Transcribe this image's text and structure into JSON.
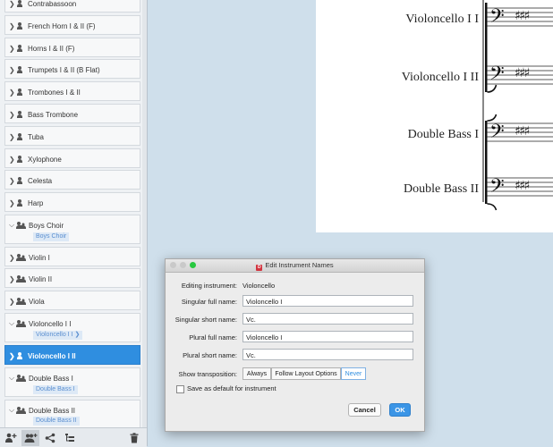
{
  "instrument_list": {
    "items": [
      {
        "label": "Contrabassoon",
        "icon": "person-icon",
        "collapsed": true
      },
      {
        "label": "French Horn I & II (F)",
        "icon": "person-icon",
        "collapsed": true
      },
      {
        "label": "Horns I & II (F)",
        "icon": "person-icon",
        "collapsed": true
      },
      {
        "label": "Trumpets I & II (B Flat)",
        "icon": "person-icon",
        "collapsed": true
      },
      {
        "label": "Trombones I & II",
        "icon": "person-icon",
        "collapsed": true
      },
      {
        "label": "Bass Trombone",
        "icon": "person-icon",
        "collapsed": true
      },
      {
        "label": "Tuba",
        "icon": "person-icon",
        "collapsed": true
      },
      {
        "label": "Xylophone",
        "icon": "person-icon",
        "collapsed": true
      },
      {
        "label": "Celesta",
        "icon": "person-icon",
        "collapsed": true
      },
      {
        "label": "Harp",
        "icon": "person-icon",
        "collapsed": true
      },
      {
        "label": "Boys Choir",
        "icon": "group-icon",
        "collapsed": false,
        "tag": "Boys Choir"
      },
      {
        "label": "Violin I",
        "icon": "group-icon",
        "collapsed": true
      },
      {
        "label": "Violin II",
        "icon": "group-icon",
        "collapsed": true
      },
      {
        "label": "Viola",
        "icon": "group-icon",
        "collapsed": true
      },
      {
        "label": "Violoncello I I",
        "icon": "group-icon",
        "collapsed": false,
        "tag": "Violoncello I I"
      },
      {
        "label": "Violoncello I II",
        "icon": "person-icon",
        "collapsed": true,
        "selected": true
      },
      {
        "label": "Double Bass I",
        "icon": "group-icon",
        "collapsed": false,
        "tag": "Double Bass I"
      },
      {
        "label": "Double Bass II",
        "icon": "group-icon",
        "collapsed": false,
        "tag": "Double Bass II"
      }
    ]
  },
  "toolbar": {
    "buttons": [
      "add-solo-player-icon",
      "add-section-player-icon",
      "share-icon",
      "hierarchy-icon"
    ],
    "trash": "trash-icon"
  },
  "score": {
    "staves": [
      "Violoncello I I",
      "Violoncello I II",
      "Double Bass I",
      "Double Bass II"
    ],
    "clef": "𝄢",
    "key_signature": "♯ ♯ ♯"
  },
  "dialog": {
    "title": "Edit Instrument Names",
    "editing_label": "Editing instrument:",
    "editing_value": "Violoncello",
    "singular_full_label": "Singular full name:",
    "singular_full_value": "Violoncello I",
    "singular_short_label": "Singular short name:",
    "singular_short_value": "Vc.",
    "plural_full_label": "Plural full name:",
    "plural_full_value": "Violoncello I",
    "plural_short_label": "Plural short name:",
    "plural_short_value": "Vc.",
    "transposition_label": "Show transposition:",
    "transposition_options": [
      "Always",
      "Follow Layout Options",
      "Never"
    ],
    "transposition_selected": "Never",
    "save_default_label": "Save as default for instrument",
    "cancel_label": "Cancel",
    "ok_label": "OK",
    "colors": {
      "accent": "#2f8ee0",
      "close": "#ff5f57",
      "minimize": "#febc2e",
      "zoom": "#28c840"
    }
  }
}
